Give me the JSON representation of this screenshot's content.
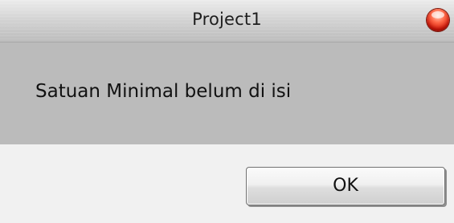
{
  "window": {
    "title": "Project1"
  },
  "message": {
    "text": "Satuan Minimal belum di isi"
  },
  "buttons": {
    "ok_label": "OK"
  },
  "icons": {
    "close": "close-icon"
  },
  "colors": {
    "close_button": "#e0301a",
    "message_background": "#bbbbbb",
    "button_area_background": "#f1f1f1"
  }
}
